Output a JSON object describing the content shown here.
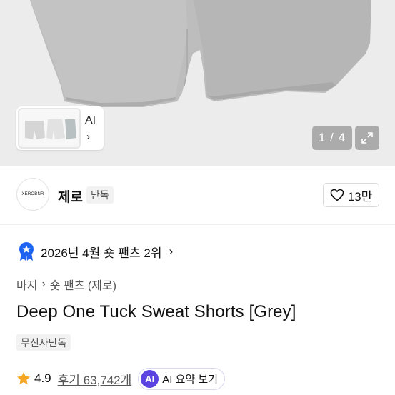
{
  "gallery": {
    "ai_label": "AI",
    "thumb_chevron": "›",
    "counter": "1 / 4",
    "expand_icon": "expand-icon"
  },
  "brand": {
    "logo_text": "XEROBNR",
    "name": "제로",
    "badge": "단독",
    "like_count": "13만"
  },
  "ranking": {
    "text": "2026년 4월 숏 팬츠 2위",
    "chevron": "›"
  },
  "breadcrumb": {
    "level1": "바지",
    "separator": "›",
    "level2": "숏 팬츠 (제로)"
  },
  "product": {
    "title": "Deep One Tuck Sweat Shorts [Grey]",
    "exclusive_badge": "무신사단독"
  },
  "rating": {
    "value": "4.9",
    "reviews": "후기 63,742개",
    "ai_summary_badge": "AI",
    "ai_summary_label": "AI 요약 보기"
  },
  "colors": {
    "accent_purple": "#5a43e0",
    "star": "#f5a623",
    "rank_badge": "#1f64f0",
    "product_grey": "#b9b9b9"
  }
}
